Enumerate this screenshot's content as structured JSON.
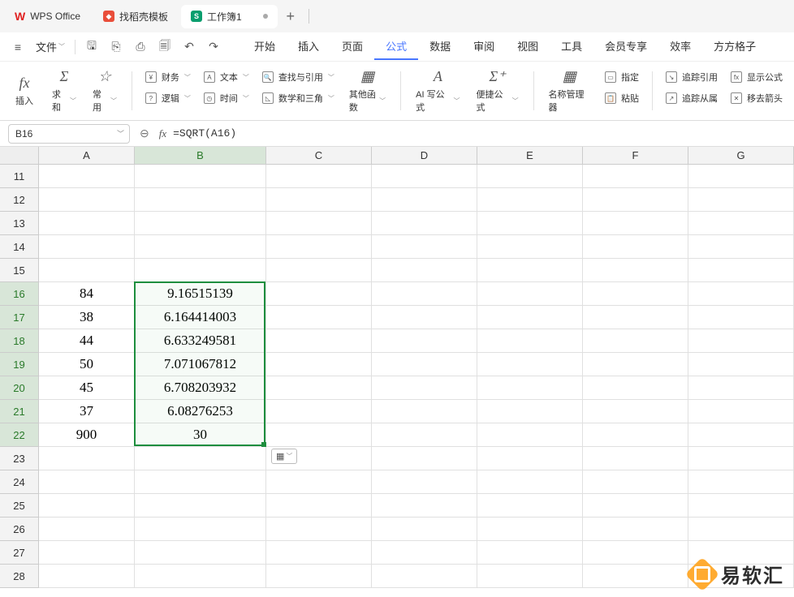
{
  "titlebar": {
    "app_name": "WPS Office",
    "templates_tab": "找稻壳模板",
    "doc_tab": "工作簿1",
    "sheet_badge": "S",
    "new_tab_plus": "+"
  },
  "menubar": {
    "hamburger": "≡",
    "file": "文件",
    "items": [
      "开始",
      "插入",
      "页面",
      "公式",
      "数据",
      "审阅",
      "视图",
      "工具",
      "会员专享",
      "效率",
      "方方格子"
    ],
    "active_index": 3
  },
  "ribbon": {
    "big": {
      "insert_fn_icon": "fx",
      "insert_fn": "插入",
      "autosum_icon": "Σ",
      "autosum": "求和",
      "common_icon": "☆",
      "common": "常用",
      "ai_icon": "A",
      "ai_formula": "AI 写公式",
      "quick_icon": "Σ⁺",
      "quick_formula": "便捷公式",
      "name_mgr_icon": "▦",
      "name_manager": "名称管理器",
      "other_icon": "▦",
      "other_functions": "其他函数"
    },
    "small": {
      "finance": "财务",
      "text": "文本",
      "lookup": "查找与引用",
      "logic": "逻辑",
      "time": "时间",
      "math": "数学和三角",
      "define": "指定",
      "paste": "粘贴",
      "trace_ref": "追踪引用",
      "trace_dep": "追踪从属",
      "show_formula": "显示公式",
      "remove_arrows": "移去箭头"
    }
  },
  "formula_bar": {
    "name_box": "B16",
    "fx_label": "fx",
    "formula": "=SQRT(A16)"
  },
  "columns": {
    "widths": [
      118,
      162,
      130,
      130,
      130,
      130,
      130
    ],
    "labels": [
      "A",
      "B",
      "C",
      "D",
      "E",
      "F",
      "G"
    ]
  },
  "rows_start": 11,
  "rows_end": 28,
  "selection": {
    "col_start": 1,
    "row_start": 16,
    "row_end": 22
  },
  "chart_data": {
    "type": "table",
    "cells": [
      {
        "r": 16,
        "c": "A",
        "v": "84"
      },
      {
        "r": 16,
        "c": "B",
        "v": "9.16515139"
      },
      {
        "r": 17,
        "c": "A",
        "v": "38"
      },
      {
        "r": 17,
        "c": "B",
        "v": "6.164414003"
      },
      {
        "r": 18,
        "c": "A",
        "v": "44"
      },
      {
        "r": 18,
        "c": "B",
        "v": "6.633249581"
      },
      {
        "r": 19,
        "c": "A",
        "v": "50"
      },
      {
        "r": 19,
        "c": "B",
        "v": "7.071067812"
      },
      {
        "r": 20,
        "c": "A",
        "v": "45"
      },
      {
        "r": 20,
        "c": "B",
        "v": "6.708203932"
      },
      {
        "r": 21,
        "c": "A",
        "v": "37"
      },
      {
        "r": 21,
        "c": "B",
        "v": "6.08276253"
      },
      {
        "r": 22,
        "c": "A",
        "v": "900"
      },
      {
        "r": 22,
        "c": "B",
        "v": "30"
      }
    ]
  },
  "watermark": {
    "text": "易软汇"
  },
  "paste_options_icon": "▦"
}
